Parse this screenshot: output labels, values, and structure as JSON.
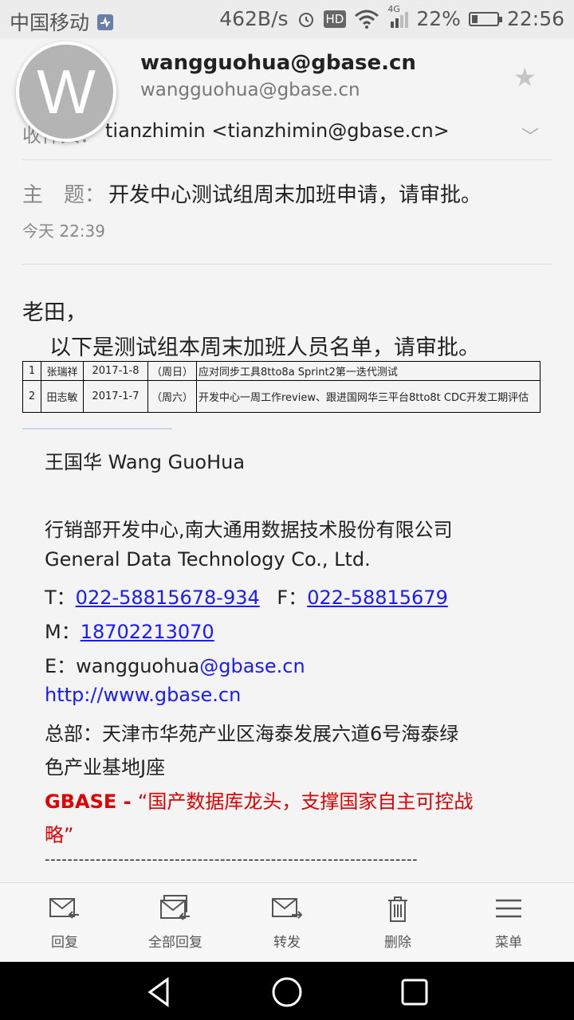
{
  "status_bar": {
    "carrier": "中国移动",
    "speed": "462B/s",
    "hd": "HD",
    "network": "4G",
    "battery": "22%",
    "battery_level": 0.22,
    "time": "22:56"
  },
  "sender": {
    "avatar_letter": "W",
    "name": "wangguohua@gbase.cn",
    "email": "wangguohua@gbase.cn"
  },
  "recipients": {
    "label": "收件人：",
    "value": "tianzhimin <tianzhimin@gbase.cn>"
  },
  "subject": {
    "label": "主　题：",
    "value": "开发中心测试组周末加班申请，请审批。"
  },
  "time": "今天 22:39",
  "body": {
    "greeting": "老田，",
    "intro": "以下是测试组本周末加班人员名单，请审批。",
    "table": [
      [
        "1",
        "张瑞祥",
        "2017-1-8",
        "（周日）",
        "应对同步工具8tto8a Sprint2第一迭代测试"
      ],
      [
        "2",
        "田志敏",
        "2017-1-7",
        "（周六）",
        "开发中心一周工作review、跟进国网华三平台8tto8t CDC开发工期评估"
      ]
    ]
  },
  "signature": {
    "name": "王国华 Wang GuoHua",
    "dept": "行销部开发中心,南大通用数据技术股份有限公司",
    "company_en": "General Data Technology Co., Ltd.",
    "tel_label": "T：",
    "tel": "022-58815678-934",
    "fax_label": "F：",
    "fax": "022-58815679",
    "mobile_label": "M：",
    "mobile": "18702213070",
    "email_label": "E：",
    "email_user": "wangguohua",
    "email_domain": "@gbase.cn",
    "website": "http://www.gbase.cn",
    "hq_line1": "总部：天津市华苑产业区海泰发展六道6号海泰绿",
    "hq_line2": "色产业基地J座",
    "slogan_brand": "GBASE - ",
    "slogan_line1": "“国产数据库龙头，支撑国家自主可控战",
    "slogan_line2": "略”",
    "separator": "------------------------------------------------------------------"
  },
  "toolbar": {
    "reply": "回复",
    "reply_all": "全部回复",
    "forward": "转发",
    "delete": "删除",
    "menu": "菜单"
  },
  "colors": {
    "link": "#1a1aff",
    "slogan": "#e00000",
    "avatar": "#b4b4b4"
  }
}
